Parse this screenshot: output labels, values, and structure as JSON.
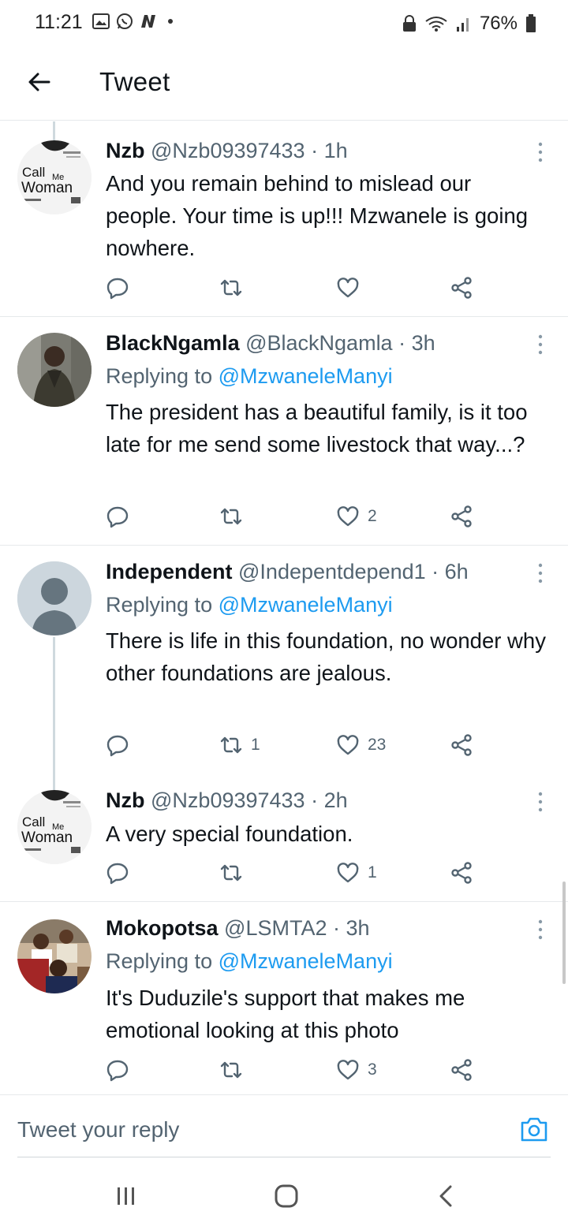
{
  "status_bar": {
    "time": "11:21",
    "battery": "76%",
    "left_icons": [
      "image-icon",
      "whatsapp-icon",
      "n-app-icon"
    ],
    "right_icons": [
      "lock-icon",
      "wifi-icon",
      "signal-icon",
      "battery-icon"
    ]
  },
  "header": {
    "title": "Tweet"
  },
  "tweets": [
    {
      "name": "Nzb",
      "handle": "@Nzb09397433",
      "time": "· 1h",
      "replying": "",
      "body": "And you remain behind to mislead our people. Your time is up!!! Mzwanele is going nowhere.",
      "retweets": "",
      "likes": "",
      "avatar": "call-me-woman"
    },
    {
      "name": "BlackNgamla",
      "handle": "@BlackNgamla",
      "time": "· 3h",
      "replying_prefix": "Replying to",
      "replying_mention": "@MzwaneleManyi",
      "body": "The president has a beautiful family, is it too late for me send some livestock that way...?",
      "retweets": "",
      "likes": "2",
      "avatar": "person-photo"
    },
    {
      "name": "Independent",
      "handle": "@Indepentdepend1",
      "time": "· 6h",
      "replying_prefix": "Replying to",
      "replying_mention": "@MzwaneleManyi",
      "body": "There is life in this foundation, no wonder why other foundations are jealous.",
      "retweets": "1",
      "likes": "23",
      "avatar": "default-avatar"
    },
    {
      "name": "Nzb",
      "handle": "@Nzb09397433",
      "time": "· 2h",
      "replying": "",
      "body": "A very special foundation.",
      "retweets": "",
      "likes": "1",
      "avatar": "call-me-woman"
    },
    {
      "name": "Mokopotsa",
      "handle": "@LSMTA2",
      "time": "· 3h",
      "replying_prefix": "Replying to",
      "replying_mention": "@MzwaneleManyi",
      "body": "It's Duduzile's support  that makes me emotional looking at this photo",
      "retweets": "",
      "likes": "3",
      "avatar": "group-photo"
    }
  ],
  "avatar_text": {
    "call": "Call",
    "me": "Me",
    "woman": "Woman"
  },
  "reply_bar": {
    "placeholder": "Tweet your reply"
  },
  "colors": {
    "accent": "#1d9bf0",
    "text": "#0f1419",
    "muted": "#536471",
    "divider": "#e6e9eb"
  }
}
